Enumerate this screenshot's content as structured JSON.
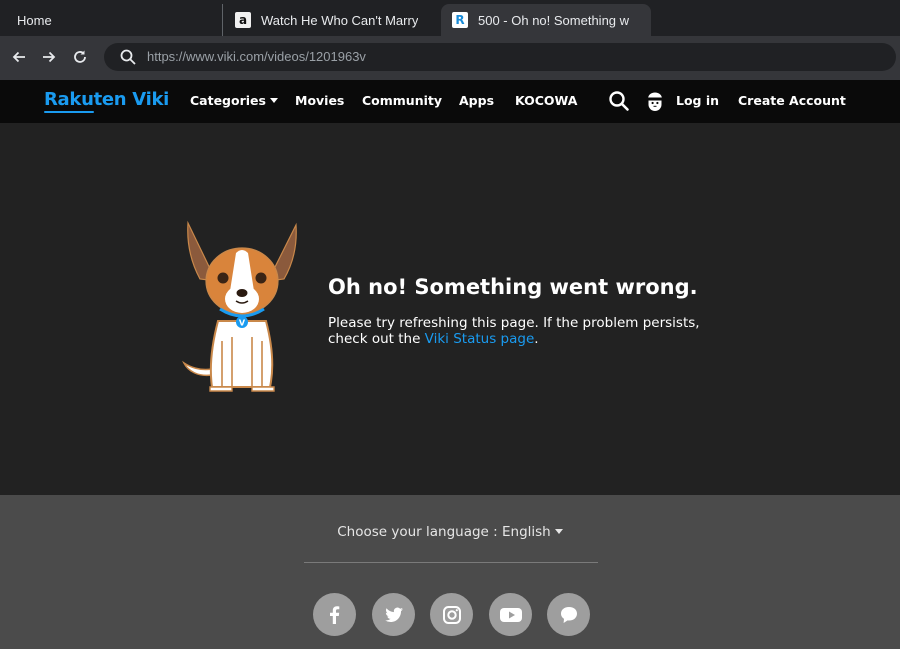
{
  "browser": {
    "tabs": [
      {
        "title": "Home"
      },
      {
        "title": "Watch He Who Can't Marry",
        "favicon": "a"
      },
      {
        "title": "500 - Oh no! Something w",
        "favicon": "R"
      }
    ],
    "url": "https://www.viki.com/videos/1201963v"
  },
  "header": {
    "logo": "Rakuten Viki",
    "nav": {
      "categories": "Categories",
      "movies": "Movies",
      "community": "Community",
      "apps": "Apps",
      "kocowa": "KOCOWA",
      "login": "Log in",
      "create_account": "Create Account"
    }
  },
  "error": {
    "title": "Oh no! Something went wrong.",
    "message": "Please try refreshing this page. If the problem persists, check out the ",
    "link": "Viki Status page",
    "suffix": ".",
    "collar_tag": "V"
  },
  "footer": {
    "language": "Choose your language : English",
    "social": [
      "facebook-icon",
      "twitter-icon",
      "instagram-icon",
      "youtube-icon",
      "chat-icon"
    ]
  },
  "colors": {
    "brand": "#1a9bf0",
    "header_bg": "#0a0a0a",
    "main_bg": "#222222",
    "footer_bg": "#4b4b4b"
  }
}
